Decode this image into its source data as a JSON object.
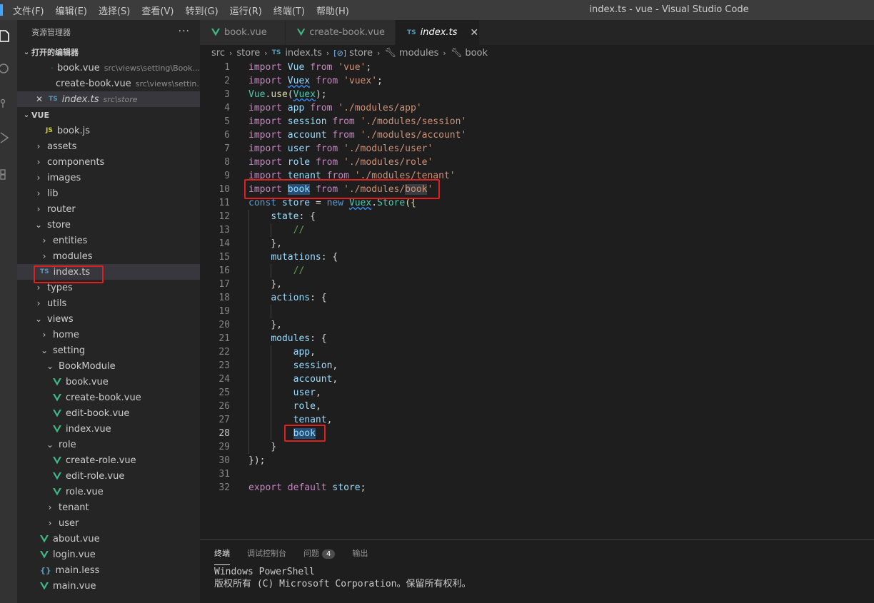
{
  "window": {
    "title": "index.ts - vue - Visual Studio Code"
  },
  "menu": [
    "文件(F)",
    "编辑(E)",
    "选择(S)",
    "查看(V)",
    "转到(G)",
    "运行(R)",
    "终端(T)",
    "帮助(H)"
  ],
  "sidebar": {
    "title": "资源管理器",
    "more": "···",
    "open_editors": {
      "header": "打开的编辑器",
      "items": [
        {
          "name": "book.vue",
          "desc": "src\\views\\setting\\Book..."
        },
        {
          "name": "create-book.vue",
          "desc": "src\\views\\settin..."
        },
        {
          "name": "index.ts",
          "desc": "src\\store",
          "badge": "TS"
        }
      ]
    },
    "workspace": {
      "header": "VUE",
      "items": [
        {
          "label": "book.js",
          "badge": "JS"
        },
        {
          "label": "assets"
        },
        {
          "label": "components"
        },
        {
          "label": "images"
        },
        {
          "label": "lib"
        },
        {
          "label": "router"
        },
        {
          "label": "store"
        },
        {
          "label": "entities"
        },
        {
          "label": "modules"
        },
        {
          "label": "index.ts",
          "badge": "TS"
        },
        {
          "label": "types"
        },
        {
          "label": "utils"
        },
        {
          "label": "views"
        },
        {
          "label": "home"
        },
        {
          "label": "setting"
        },
        {
          "label": "BookModule"
        },
        {
          "label": "book.vue"
        },
        {
          "label": "create-book.vue"
        },
        {
          "label": "edit-book.vue"
        },
        {
          "label": "index.vue"
        },
        {
          "label": "role"
        },
        {
          "label": "create-role.vue"
        },
        {
          "label": "edit-role.vue"
        },
        {
          "label": "role.vue"
        },
        {
          "label": "tenant"
        },
        {
          "label": "user"
        },
        {
          "label": "about.vue"
        },
        {
          "label": "login.vue"
        },
        {
          "label": "main.less",
          "badge": "{}"
        },
        {
          "label": "main.vue"
        }
      ]
    }
  },
  "tabs": [
    {
      "label": "book.vue"
    },
    {
      "label": "create-book.vue"
    },
    {
      "label": "index.ts",
      "badge": "TS",
      "close": "✕"
    }
  ],
  "breadcrumb": [
    "src",
    "store",
    "index.ts",
    "store",
    "modules",
    "book"
  ],
  "code": {
    "line_numbers": [
      "1",
      "2",
      "3",
      "4",
      "5",
      "6",
      "7",
      "8",
      "9",
      "10",
      "11",
      "12",
      "13",
      "14",
      "15",
      "16",
      "17",
      "18",
      "19",
      "20",
      "21",
      "22",
      "23",
      "24",
      "25",
      "26",
      "27",
      "28",
      "29",
      "30",
      "31",
      "32"
    ],
    "l1": [
      "import",
      "Vue",
      "from",
      "'vue'",
      ";"
    ],
    "l2": [
      "import",
      "Vuex",
      "from",
      "'vuex'",
      ";"
    ],
    "l3": [
      "Vue",
      ".",
      "use",
      "(",
      "Vuex",
      ");"
    ],
    "l4": [
      "import",
      "app",
      "from",
      "'./modules/app'"
    ],
    "l5": [
      "import",
      "session",
      "from",
      "'./modules/session'"
    ],
    "l6": [
      "import",
      "account",
      "from",
      "'./modules/account'"
    ],
    "l7": [
      "import",
      "user",
      "from",
      "'./modules/user'"
    ],
    "l8": [
      "import",
      "role",
      "from",
      "'./modules/role'"
    ],
    "l9": [
      "import",
      "tenant",
      "from",
      "'./modules/tenant'"
    ],
    "l10": [
      "import",
      "book",
      "from",
      "'./modules/",
      "book",
      "'"
    ],
    "l11": [
      "const",
      "store",
      "=",
      "new",
      "Vuex",
      ".",
      "Store",
      "({"
    ],
    "l12": [
      "state",
      ": {"
    ],
    "l13": [
      "//"
    ],
    "l14": [
      "},"
    ],
    "l15": [
      "mutations",
      ": {"
    ],
    "l16": [
      "//"
    ],
    "l17": [
      "},"
    ],
    "l18": [
      "actions",
      ": {"
    ],
    "l20": [
      "},"
    ],
    "l21": [
      "modules",
      ": {"
    ],
    "l22": [
      "app",
      ","
    ],
    "l23": [
      "session",
      ","
    ],
    "l24": [
      "account",
      ","
    ],
    "l25": [
      "user",
      ","
    ],
    "l26": [
      "role",
      ","
    ],
    "l27": [
      "tenant",
      ","
    ],
    "l28": [
      "book"
    ],
    "l29": [
      "}"
    ],
    "l30": [
      "});"
    ],
    "l32": [
      "export",
      "default",
      "store",
      ";"
    ]
  },
  "panel": {
    "tabs": [
      "终端",
      "调试控制台",
      "问题",
      "输出"
    ],
    "problems_count": "4",
    "terminal_lines": [
      "Windows PowerShell",
      "版权所有 (C) Microsoft Corporation。保留所有权利。"
    ]
  },
  "colors": {
    "annotation": "#e02020",
    "vue_green": "#41b883",
    "ts_blue": "#519aba"
  }
}
